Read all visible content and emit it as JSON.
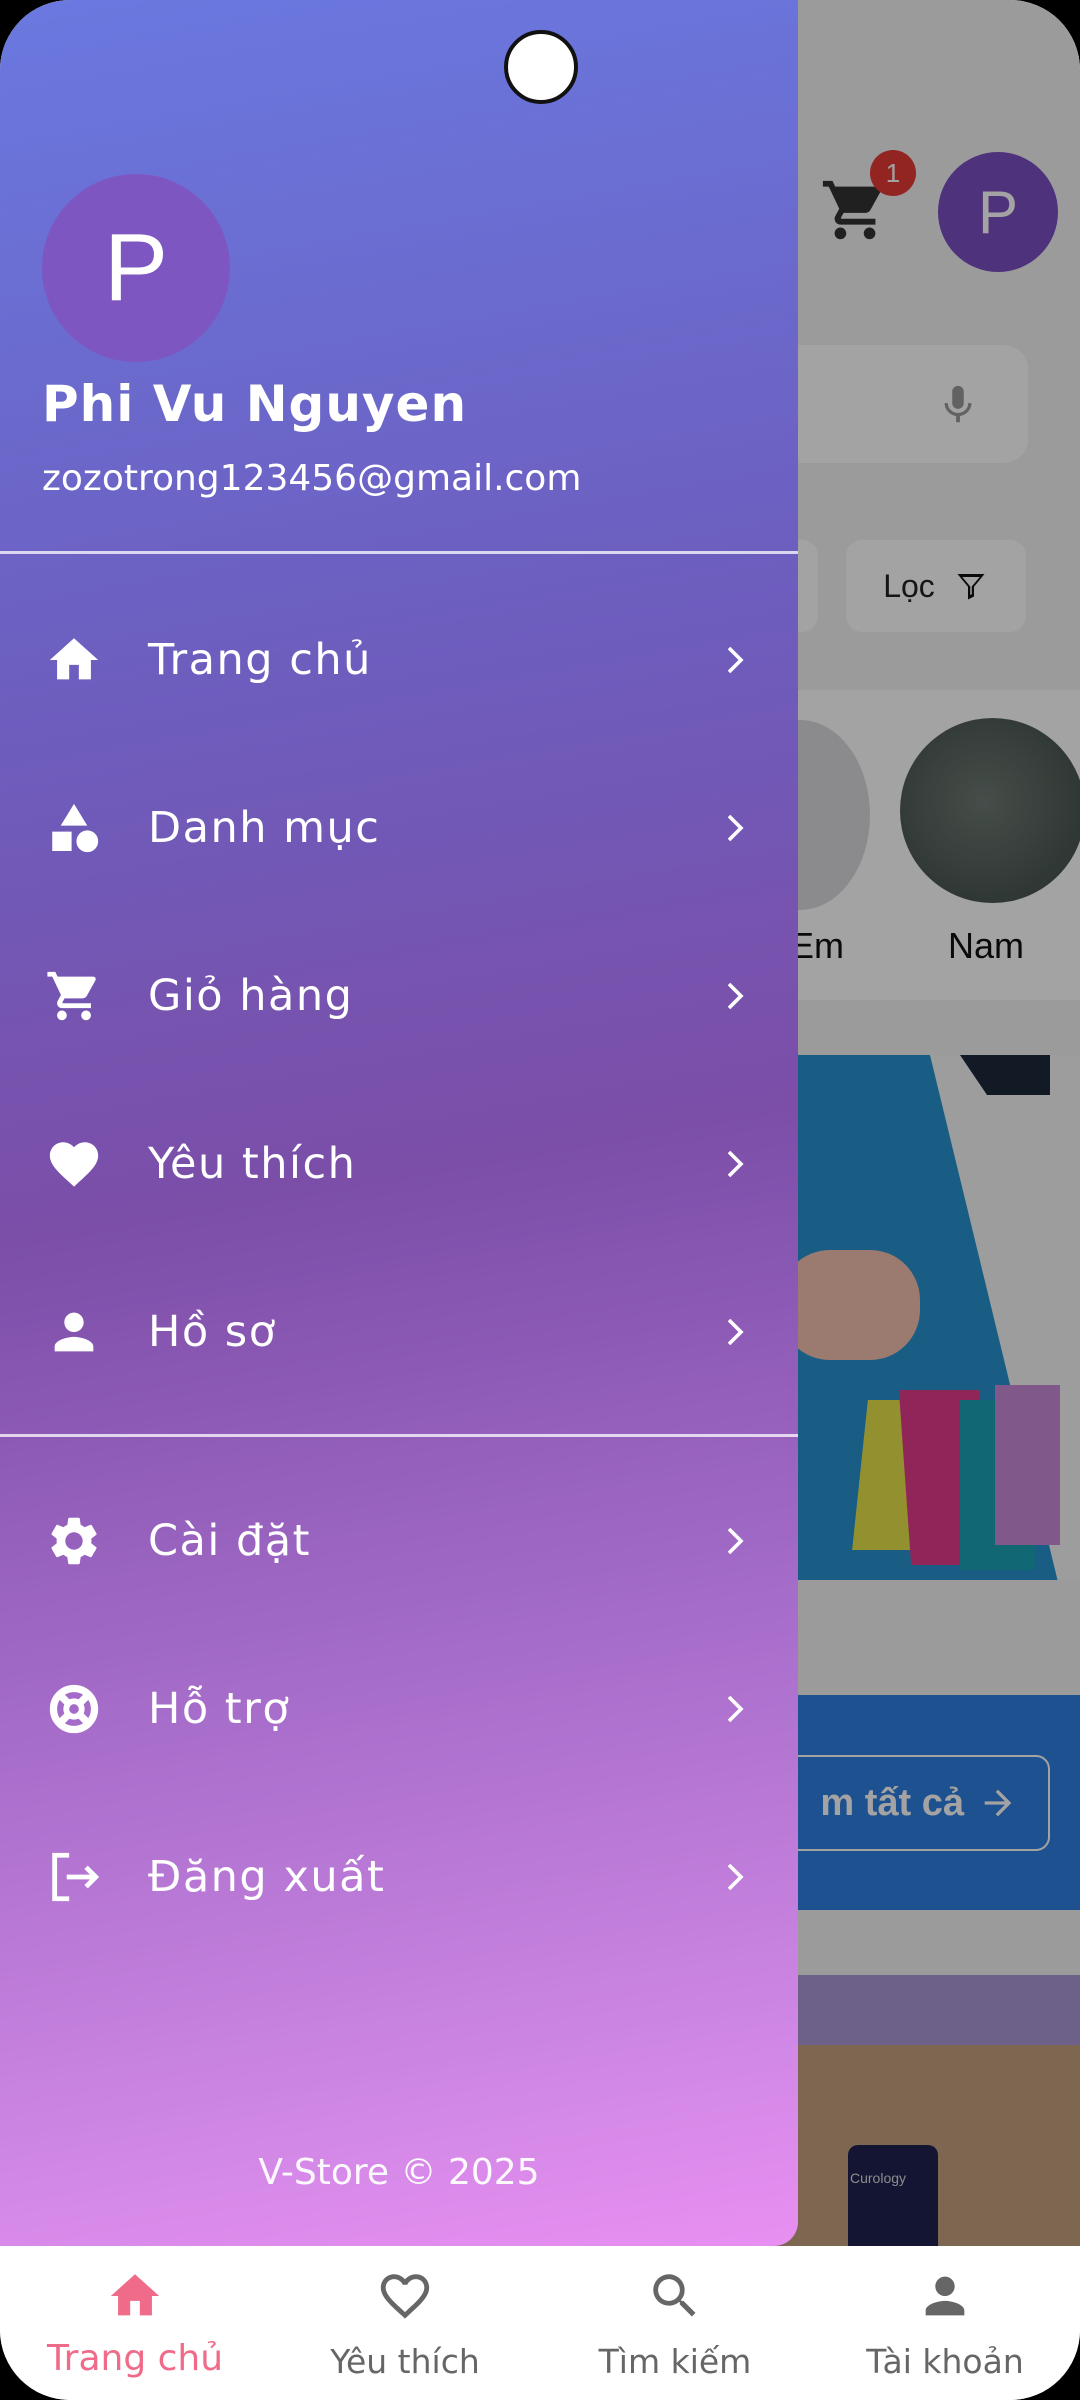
{
  "background": {
    "cart_badge": "1",
    "avatar_letter": "P",
    "filter_label": "Lọc",
    "categories": [
      "Em",
      "Nam"
    ],
    "see_all_label": "m tất cả",
    "product_brand": "Curology"
  },
  "drawer": {
    "avatar_letter": "P",
    "user_name": "Phi Vu Nguyen",
    "user_email": "zozotrong123456@gmail.com",
    "main_items": [
      {
        "label": "Trang chủ",
        "icon": "home-icon"
      },
      {
        "label": "Danh mục",
        "icon": "category-icon"
      },
      {
        "label": "Giỏ hàng",
        "icon": "cart-icon"
      },
      {
        "label": "Yêu thích",
        "icon": "heart-icon"
      },
      {
        "label": "Hồ sơ",
        "icon": "person-icon"
      }
    ],
    "secondary_items": [
      {
        "label": "Cài đặt",
        "icon": "gear-icon"
      },
      {
        "label": "Hỗ trợ",
        "icon": "support-icon"
      },
      {
        "label": "Đăng xuất",
        "icon": "logout-icon"
      }
    ],
    "footer": "V-Store © 2025"
  },
  "bottom_nav": {
    "items": [
      {
        "label": "Trang chủ",
        "icon": "home-icon",
        "active": true
      },
      {
        "label": "Yêu thích",
        "icon": "heart-outline-icon",
        "active": false
      },
      {
        "label": "Tìm kiếm",
        "icon": "search-icon",
        "active": false
      },
      {
        "label": "Tài khoản",
        "icon": "person-icon",
        "active": false
      }
    ]
  },
  "colors": {
    "drawer_gradient_top": "#6a79e0",
    "drawer_gradient_bottom": "#e98ff2",
    "nav_active": "#f06b8a",
    "nav_inactive": "#666666"
  }
}
